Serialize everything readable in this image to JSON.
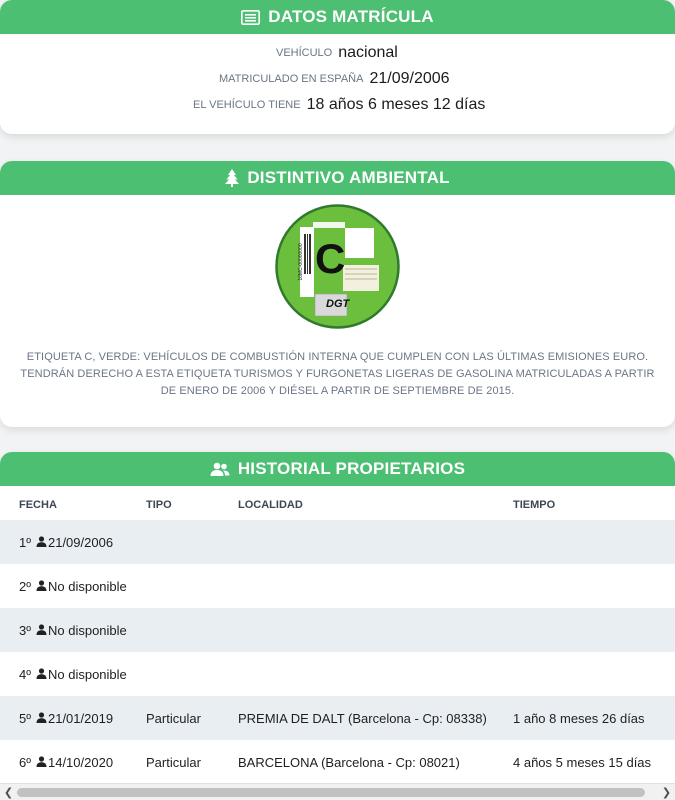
{
  "matricula": {
    "title": "DATOS MATRÍCULA",
    "rows": [
      {
        "label": "VEHÍCULO",
        "value": "nacional"
      },
      {
        "label": "MATRICULADO EN ESPAÑA",
        "value": "21/09/2006"
      },
      {
        "label": "EL VEHÍCULO TIENE",
        "value": "18 años 6 meses 12 días"
      }
    ]
  },
  "distintivo": {
    "title": "DISTINTIVO AMBIENTAL",
    "badge_letter": "C",
    "badge_code": "16MC-00000000",
    "badge_logo": "DGT",
    "description": "ETIQUETA C, VERDE: VEHÍCULOS DE COMBUSTIÓN INTERNA QUE CUMPLEN CON LAS ÚLTIMAS EMISIONES EURO. TENDRÁN DERECHO A ESTA ETIQUETA TURISMOS Y FURGONETAS LIGERAS DE GASOLINA MATRICULADAS A PARTIR DE ENERO DE 2006 Y DIÉSEL A PARTIR DE SEPTIEMBRE DE 2015.",
    "colors": {
      "badge_green": "#6cbf3c",
      "badge_border": "#2f7a2d"
    }
  },
  "historial": {
    "title": "HISTORIAL PROPIETARIOS",
    "columns": [
      "FECHA",
      "TIPO",
      "LOCALIDAD",
      "TIEMPO"
    ],
    "rows": [
      {
        "num": "1º",
        "fecha": "21/09/2006",
        "tipo": "",
        "localidad": "",
        "tiempo": ""
      },
      {
        "num": "2º",
        "fecha": "No disponible",
        "tipo": "",
        "localidad": "",
        "tiempo": ""
      },
      {
        "num": "3º",
        "fecha": "No disponible",
        "tipo": "",
        "localidad": "",
        "tiempo": ""
      },
      {
        "num": "4º",
        "fecha": "No disponible",
        "tipo": "",
        "localidad": "",
        "tiempo": ""
      },
      {
        "num": "5º",
        "fecha": "21/01/2019",
        "tipo": "Particular",
        "localidad": "PREMIA DE DALT (Barcelona - Cp: 08338)",
        "tiempo": "1 año 8 meses 26 días"
      },
      {
        "num": "6º",
        "fecha": "14/10/2020",
        "tipo": "Particular",
        "localidad": "BARCELONA (Barcelona - Cp: 08021)",
        "tiempo": "4 años 5 meses 15 días"
      }
    ]
  },
  "icons": {
    "matricula": "list-card-icon",
    "distintivo": "tree-icon",
    "historial": "users-icon",
    "row": "user-icon"
  },
  "colors": {
    "accent": "#4cbf73",
    "row_alt": "#e9eef3",
    "muted": "#6b7586"
  }
}
